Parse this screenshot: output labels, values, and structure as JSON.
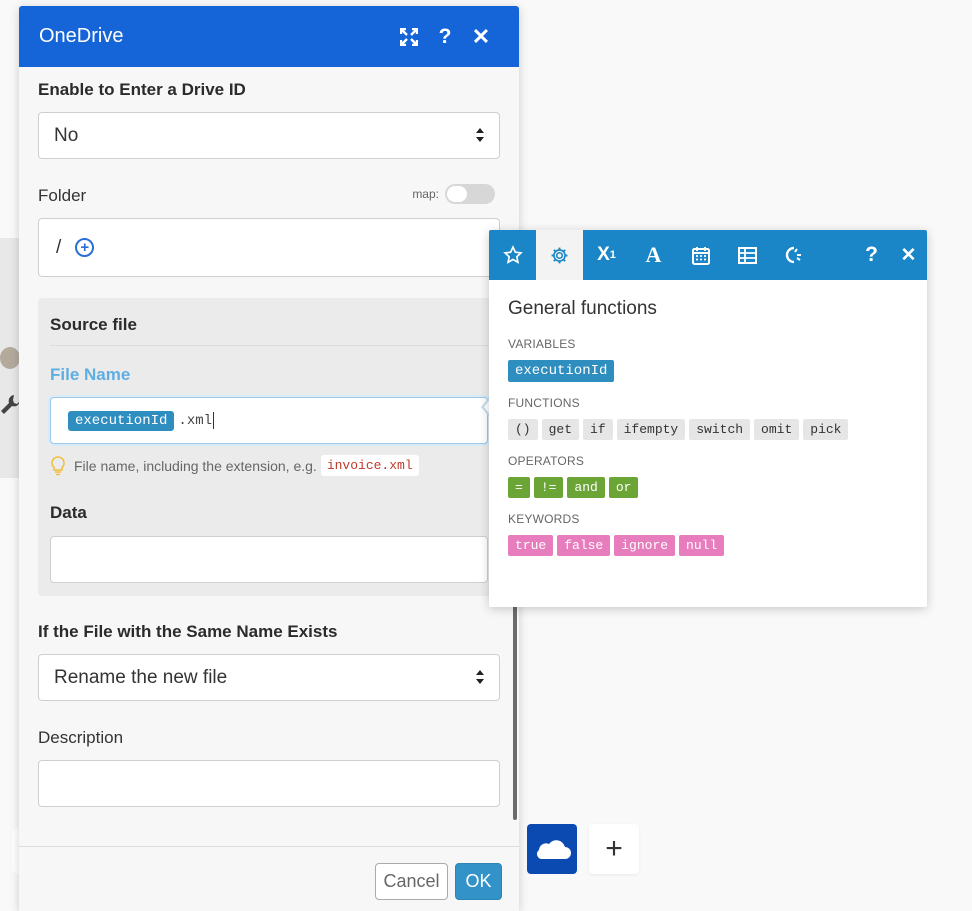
{
  "dialog": {
    "title": "OneDrive",
    "header_icons": [
      "expand-icon",
      "help-icon",
      "close-icon"
    ],
    "accent_color": "#1565d8"
  },
  "fields": {
    "drive_id_label": "Enable to Enter a Drive ID",
    "drive_id_value": "No",
    "folder_label": "Folder",
    "map_label": "map:",
    "folder_value": "/",
    "source_file_title": "Source file",
    "file_name_label": "File Name",
    "file_name_variable": "executionId",
    "file_name_suffix": ".xml",
    "file_name_hint": "File name, including the extension, e.g.",
    "file_name_hint_example": "invoice.xml",
    "data_label": "Data",
    "data_value": "",
    "exists_label": "If the File with the Same Name Exists",
    "exists_value": "Rename the new file",
    "description_label": "Description",
    "description_value": ""
  },
  "footer": {
    "cancel_label": "Cancel",
    "ok_label": "OK"
  },
  "picker": {
    "tabs": [
      "star-icon",
      "gear-icon",
      "superscript-icon",
      "text-icon",
      "calendar-icon",
      "table-icon",
      "hash-icon"
    ],
    "active_tab": "gear-icon",
    "title": "General functions",
    "variables_label": "VARIABLES",
    "variables": [
      "executionId"
    ],
    "functions_label": "FUNCTIONS",
    "functions": [
      "()",
      "get",
      "if",
      "ifempty",
      "switch",
      "omit",
      "pick"
    ],
    "operators_label": "OPERATORS",
    "operators": [
      "=",
      "!=",
      "and",
      "or"
    ],
    "keywords_label": "KEYWORDS",
    "keywords": [
      "true",
      "false",
      "ignore",
      "null"
    ],
    "colors": {
      "tab_bar": "#1a86c7",
      "variable": "#2e8ec0",
      "operator": "#6aa536",
      "keyword": "#e77dbd"
    }
  },
  "canvas": {
    "add_label": "+",
    "app_icon": "onedrive-cloud-icon"
  }
}
